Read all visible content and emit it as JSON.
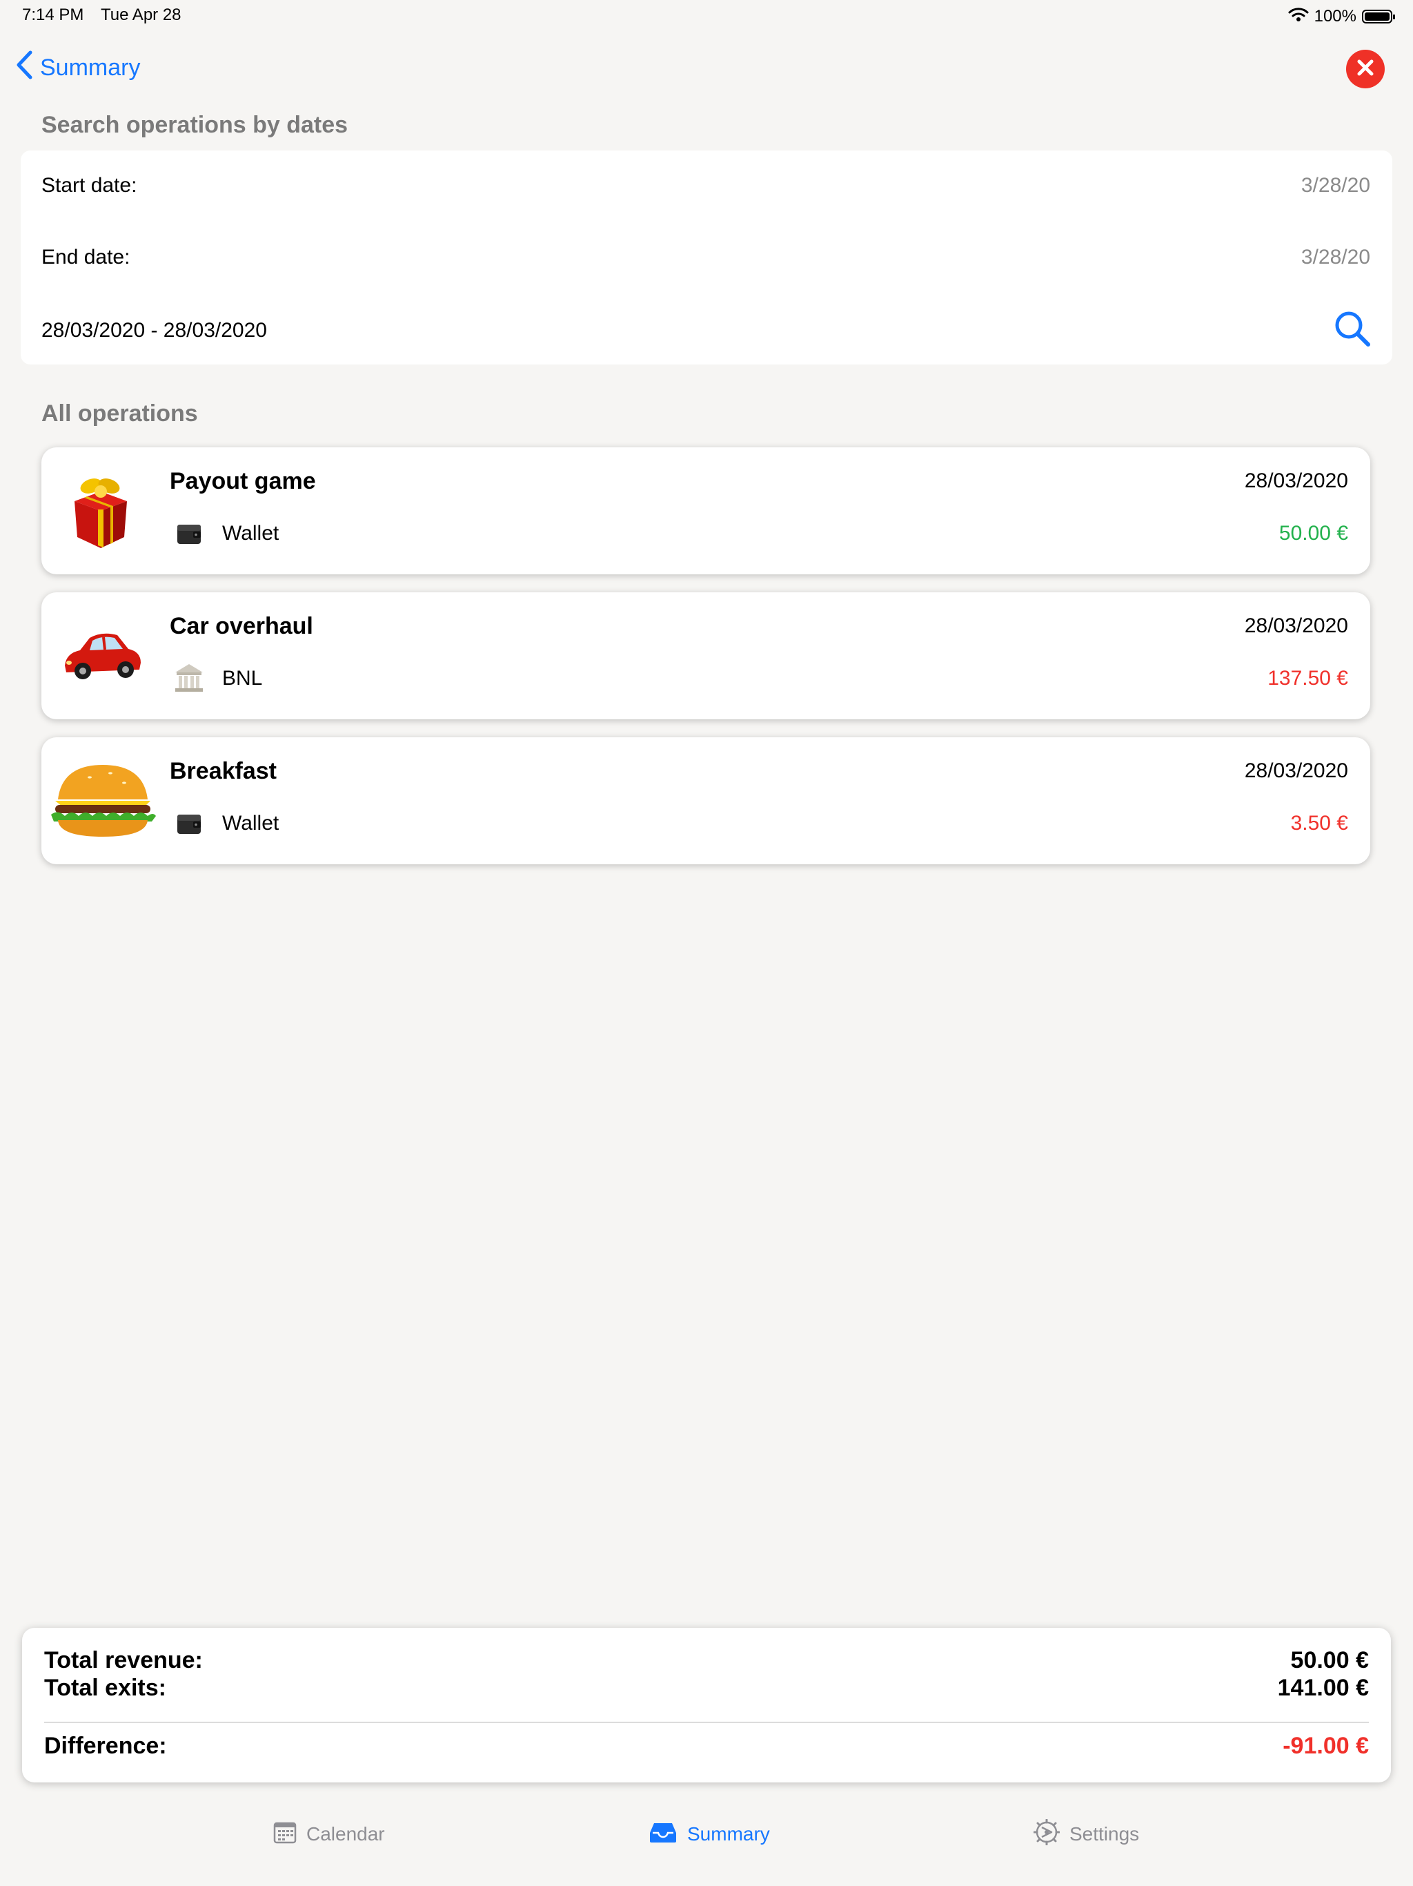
{
  "status_bar": {
    "time": "7:14 PM",
    "date": "Tue Apr 28",
    "battery": "100%"
  },
  "nav": {
    "back_label": "Summary"
  },
  "search": {
    "header": "Search operations by dates",
    "start_label": "Start date:",
    "start_value": "3/28/20",
    "end_label": "End date:",
    "end_value": "3/28/20",
    "range_text": "28/03/2020 - 28/03/2020"
  },
  "operations": {
    "header": "All operations",
    "items": [
      {
        "title": "Payout game",
        "date": "28/03/2020",
        "account": "Wallet",
        "amount": "50.00 €",
        "amount_color": "#22b14c",
        "icon": "gift-icon",
        "account_icon": "wallet-icon"
      },
      {
        "title": "Car overhaul",
        "date": "28/03/2020",
        "account": "BNL",
        "amount": "137.50 €",
        "amount_color": "#f0302a",
        "icon": "car-icon",
        "account_icon": "bank-icon"
      },
      {
        "title": "Breakfast",
        "date": "28/03/2020",
        "account": "Wallet",
        "amount": "3.50 €",
        "amount_color": "#f0302a",
        "icon": "burger-icon",
        "account_icon": "wallet-icon"
      }
    ]
  },
  "totals": {
    "revenue_label": "Total revenue:",
    "revenue_value": "50.00 €",
    "exits_label": "Total exits:",
    "exits_value": "141.00 €",
    "difference_label": "Difference:",
    "difference_value": "-91.00 €",
    "difference_color": "#f0302a"
  },
  "tabs": [
    {
      "label": "Calendar",
      "icon": "calendar-icon",
      "active": false
    },
    {
      "label": "Summary",
      "icon": "inbox-tray-icon",
      "active": true
    },
    {
      "label": "Settings",
      "icon": "gear-icon",
      "active": false
    }
  ],
  "colors": {
    "accent": "#1677ff",
    "positive": "#22b14c",
    "negative": "#f0302a",
    "close": "#ef3127"
  }
}
